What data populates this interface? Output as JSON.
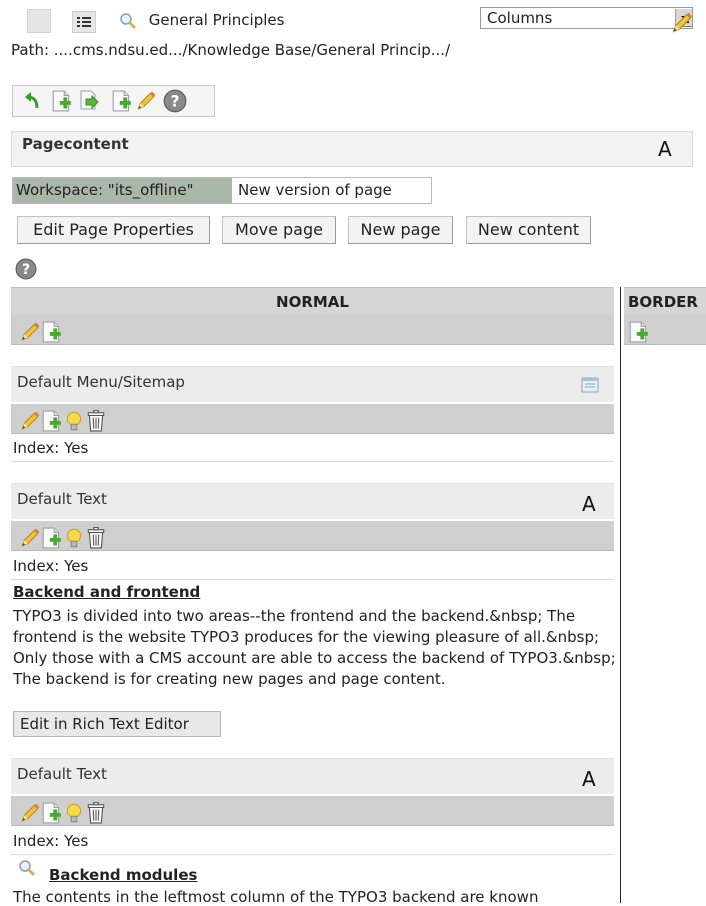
{
  "header": {
    "page_title": "General Principles",
    "view_select": "Columns",
    "path": "Path: ....cms.ndsu.ed.../Knowledge Base/General Princip.../"
  },
  "pagecontent": {
    "label": "Pagecontent",
    "a_icon": "A"
  },
  "workspace": {
    "label": "Workspace: \"its_offline\"",
    "value": "New version of page"
  },
  "buttons": {
    "edit_page_properties": "Edit Page Properties",
    "move_page": "Move page",
    "new_page": "New page",
    "new_content": "New content"
  },
  "columns": {
    "normal": "NORMAL",
    "border": "BORDER"
  },
  "elements": [
    {
      "title": "Default Menu/Sitemap",
      "index": "Index: Yes"
    },
    {
      "title": "Default Text",
      "a_icon": "A",
      "index": "Index: Yes",
      "heading": "Backend and frontend",
      "body": "TYPO3 is divided into two areas--the frontend and the backend.&nbsp; The frontend is the website TYPO3 produces for the viewing pleasure of all.&nbsp; Only those with a CMS account are able to access the backend of TYPO3.&nbsp; The backend is for creating new pages and page content.",
      "rte_button": "Edit in Rich Text Editor"
    },
    {
      "title": "Default Text",
      "a_icon": "A",
      "index": "Index: Yes",
      "heading": "Backend modules",
      "body_partial": "The contents in the leftmost column of the TYPO3 backend are known"
    }
  ],
  "icons": [
    "list-icon",
    "magnifier-icon",
    "dropdown-arrow-icon",
    "pencil-icon",
    "undo-icon",
    "new-record-icon",
    "move-icon",
    "help-icon",
    "sitemap-icon",
    "lightbulb-icon",
    "trash-icon"
  ]
}
